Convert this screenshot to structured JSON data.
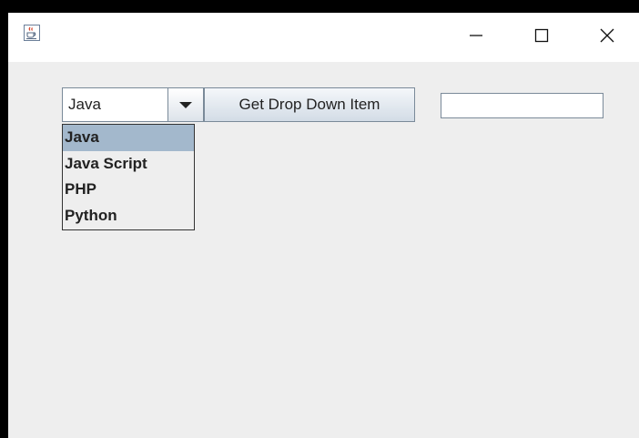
{
  "window": {
    "icons": {
      "app": "java-cup-icon",
      "minimize": "minimize-icon",
      "maximize": "maximize-icon",
      "close": "close-icon"
    }
  },
  "combo": {
    "selected_value": "Java",
    "options": [
      "Java",
      "Java Script",
      "PHP",
      "Python"
    ],
    "highlighted_index": 0
  },
  "button": {
    "label": "Get Drop Down Item"
  },
  "text_field": {
    "value": ""
  },
  "colors": {
    "selection": "#a3b8cc",
    "background": "#eeeeee",
    "border": "#7a8a99"
  }
}
